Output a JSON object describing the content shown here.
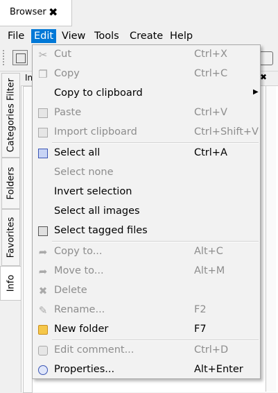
{
  "window": {
    "tab_title": "Browser",
    "tab_close": "✖"
  },
  "menubar": {
    "items": [
      "File",
      "Edit",
      "View",
      "Tools",
      "Create",
      "Help"
    ],
    "active": "Edit"
  },
  "side_tabs": [
    "Categories Filter",
    "Folders",
    "Favorites",
    "Info"
  ],
  "content": {
    "header_text": "In",
    "header_close": "✖"
  },
  "edit_menu": {
    "items": [
      {
        "label": "Cut",
        "shortcut": "Ctrl+X",
        "enabled": false,
        "icon": "scissors-icon"
      },
      {
        "label": "Copy",
        "shortcut": "Ctrl+C",
        "enabled": false,
        "icon": "copy-icon"
      },
      {
        "label": "Copy to clipboard",
        "shortcut": "",
        "enabled": true,
        "icon": "",
        "submenu": true
      },
      {
        "label": "Paste",
        "shortcut": "Ctrl+V",
        "enabled": false,
        "icon": "paste-icon"
      },
      {
        "label": "Import clipboard",
        "shortcut": "Ctrl+Shift+V",
        "enabled": false,
        "icon": "clipboard-icon"
      },
      {
        "label": "Select all",
        "shortcut": "Ctrl+A",
        "enabled": true,
        "icon": "select-all-icon"
      },
      {
        "label": "Select none",
        "shortcut": "",
        "enabled": false,
        "icon": ""
      },
      {
        "label": "Invert selection",
        "shortcut": "",
        "enabled": true,
        "icon": ""
      },
      {
        "label": "Select all images",
        "shortcut": "",
        "enabled": true,
        "icon": ""
      },
      {
        "label": "Select tagged files",
        "shortcut": "",
        "enabled": true,
        "icon": "tagged-files-icon"
      },
      {
        "label": "Copy to...",
        "shortcut": "Alt+C",
        "enabled": false,
        "icon": "copy-to-icon"
      },
      {
        "label": "Move to...",
        "shortcut": "Alt+M",
        "enabled": false,
        "icon": "move-to-icon"
      },
      {
        "label": "Delete",
        "shortcut": "",
        "enabled": false,
        "icon": "delete-icon"
      },
      {
        "label": "Rename...",
        "shortcut": "F2",
        "enabled": false,
        "icon": "rename-icon"
      },
      {
        "label": "New folder",
        "shortcut": "F7",
        "enabled": true,
        "icon": "new-folder-icon"
      },
      {
        "label": "Edit comment...",
        "shortcut": "Ctrl+D",
        "enabled": false,
        "icon": "comment-icon"
      },
      {
        "label": "Properties...",
        "shortcut": "Alt+Enter",
        "enabled": true,
        "icon": "properties-icon"
      }
    ],
    "submenu_arrow": "▶"
  },
  "colors": {
    "menu_highlight": "#0078d7",
    "disabled_text": "#8d8d8d",
    "menu_bg": "#f2f2f2"
  }
}
